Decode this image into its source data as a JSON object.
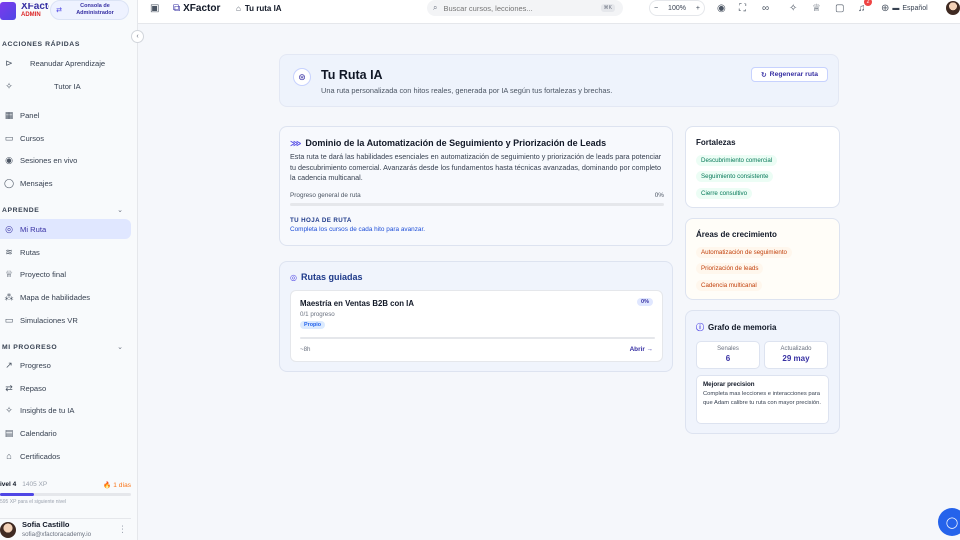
{
  "brand": {
    "name": "XFactor",
    "admin_label": "ADMIN",
    "console_label": "Consola de Administrador"
  },
  "sidebar": {
    "quick_title": "ACCIONES RÁPIDAS",
    "quick": [
      "Reanudar Aprendizaje",
      "Tutor IA"
    ],
    "main": [
      "Panel",
      "Cursos",
      "Sesiones en vivo",
      "Mensajes"
    ],
    "aprende_title": "APRENDE",
    "aprende": [
      "Mi Ruta",
      "Rutas",
      "Proyecto final",
      "Mapa de habilidades",
      "Simulaciones VR"
    ],
    "progreso_title": "MI PROGRESO",
    "progreso": [
      "Progreso",
      "Repaso",
      "Insights de tu IA",
      "Calendario",
      "Certificados"
    ],
    "level": {
      "label": "ivel 4",
      "xp": "1405 XP",
      "streak": "🔥 1 días",
      "progress": 0.26,
      "note": "595 XP para el siguiente nivel"
    },
    "user": {
      "name": "Sofia Castillo",
      "email": "sofia@xfactoracademy.io"
    }
  },
  "topbar": {
    "brand": "XFactor",
    "crumb": "Tu ruta IA",
    "search_placeholder": "Buscar cursos, lecciones...",
    "search_kbd": "⌘K",
    "zoom": "100%",
    "notif_count": "2",
    "language": "Español"
  },
  "hero": {
    "title": "Tu Ruta IA",
    "subtitle": "Una ruta personalizada con hitos reales, generada por IA según tus fortalezas y brechas.",
    "regen_label": "Regenerar ruta"
  },
  "domain": {
    "title": "Dominio de la Automatización de Seguimiento y Priorización de Leads",
    "description": "Esta ruta te dará las habilidades esenciales en automatización de seguimiento y priorización de leads para potenciar tu descubrimiento comercial. Avanzarás desde los fundamentos hasta técnicas avanzadas, dominando por completo la cadencia multicanal.",
    "progress_label": "Progreso general de ruta",
    "progress_value": "0%",
    "roadmap_title": "TU HOJA DE RUTA",
    "roadmap_sub": "Completa los cursos de cada hito para avanzar."
  },
  "rutas": {
    "title": "Rutas guiadas",
    "items": [
      {
        "title": "Maestría en Ventas B2B con IA",
        "pct": "0%",
        "progress": "0/1 progreso",
        "tag": "Propio",
        "duration": "~8h",
        "open": "Abrir →"
      }
    ]
  },
  "fortalezas": {
    "title": "Fortalezas",
    "items": [
      "Descubrimiento comercial",
      "Seguimiento consistente",
      "Cierre consultivo"
    ]
  },
  "areas": {
    "title": "Áreas de crecimiento",
    "items": [
      "Automatización de seguimiento",
      "Priorización de leads",
      "Cadencia multicanal"
    ]
  },
  "memoria": {
    "title": "Grafo de memoria",
    "signals_label": "Senales",
    "signals_value": "6",
    "updated_label": "Actualizado",
    "updated_value": "29 may",
    "tip_title": "Mejorar precision",
    "tip_text": "Completa mas lecciones e interacciones para que Adam calibre tu ruta con mayor precisión."
  }
}
